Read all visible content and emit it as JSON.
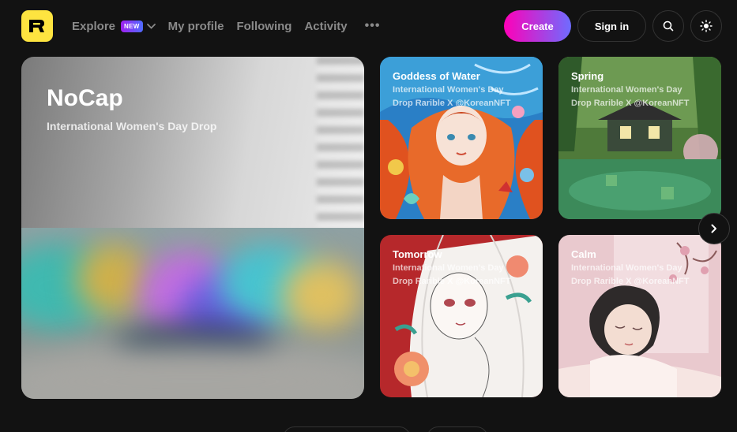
{
  "header": {
    "nav": [
      {
        "label": "Explore",
        "badge": "NEW"
      },
      {
        "label": "My profile"
      },
      {
        "label": "Following"
      },
      {
        "label": "Activity"
      }
    ],
    "more": "•••",
    "create_label": "Create",
    "signin_label": "Sign in"
  },
  "hero": {
    "title": "NoCap",
    "subtitle": "International Women's Day Drop"
  },
  "cards": [
    {
      "title": "Goddess of Water",
      "line1": "International Women's Day",
      "line2": "Drop Rarible X @KoreanNFT"
    },
    {
      "title": "Spring",
      "line1": "International Women's Day",
      "line2": "Drop Rarible X @KoreanNFT"
    },
    {
      "title": "Tomorrow",
      "line1": "International Women's Day",
      "line2": "Drop Rarible X @KoreanNFT"
    },
    {
      "title": "Calm",
      "line1": "International Women's Day",
      "line2": "Drop Rarible X @KoreanNFT"
    }
  ],
  "colors": {
    "background": "#121212",
    "logo": "#fee440",
    "create_gradient_start": "#ff00b8",
    "create_gradient_end": "#6e6cff"
  },
  "icons": [
    "rarible-logo-icon",
    "chevron-down-icon",
    "search-icon",
    "sun-icon",
    "chevron-right-icon"
  ]
}
